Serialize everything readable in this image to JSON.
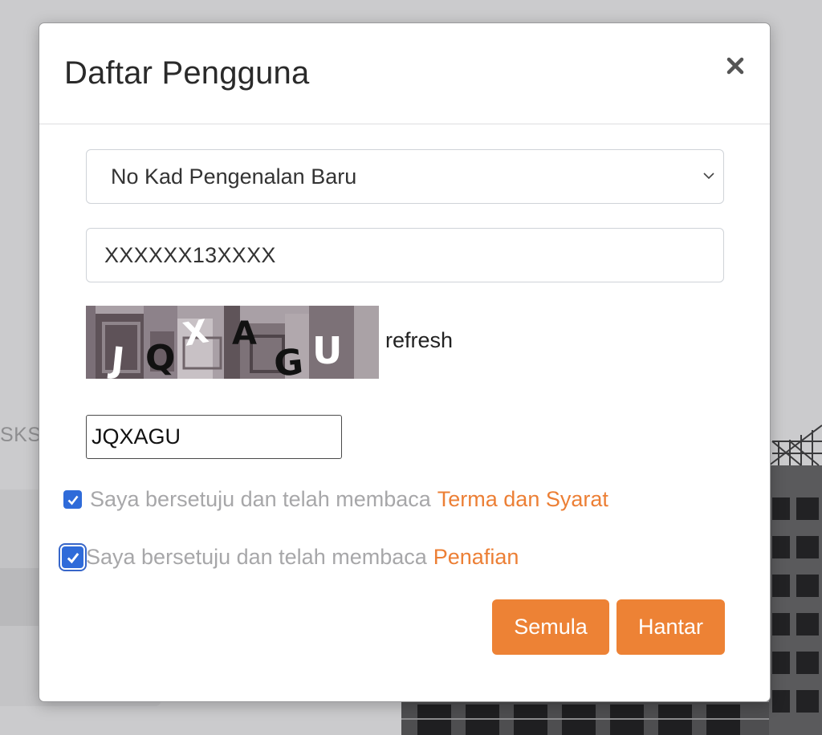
{
  "background": {
    "fragment_text": "SKS"
  },
  "modal": {
    "title": "Daftar Pengguna",
    "close_icon": "close-icon",
    "id_type_select": {
      "selected": "No Kad Pengenalan Baru"
    },
    "id_number_input": {
      "value": "XXXXXX13XXXX"
    },
    "captcha": {
      "characters": [
        "J",
        "Q",
        "X",
        "A",
        "G",
        "U"
      ],
      "refresh_label": "refresh"
    },
    "captcha_input": {
      "value": "JQXAGU"
    },
    "agreements": [
      {
        "text": "Saya bersetuju dan telah membaca",
        "link": "Terma dan Syarat",
        "checked": true
      },
      {
        "text": "Saya bersetuju dan telah membaca",
        "link": "Penafian",
        "checked": true
      }
    ],
    "buttons": {
      "reset_label": "Semula",
      "submit_label": "Hantar"
    }
  },
  "colors": {
    "accent": "#ed8235",
    "link": "#ec7f35",
    "checkbox": "#2f6bd9"
  }
}
